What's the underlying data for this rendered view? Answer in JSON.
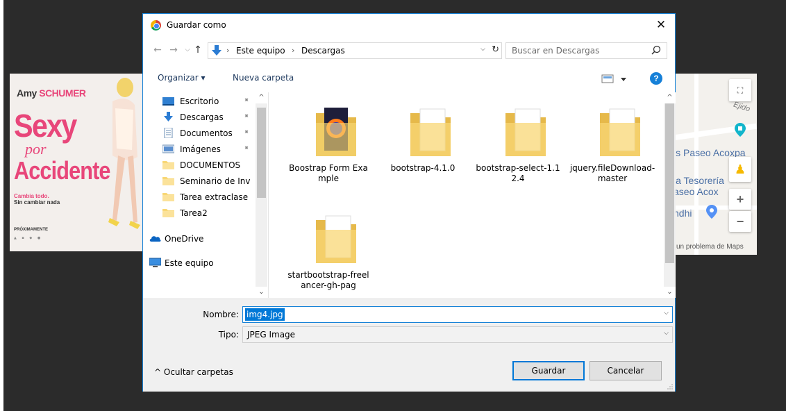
{
  "dialog": {
    "title": "Guardar como",
    "close": "✕"
  },
  "nav": {
    "back": "←",
    "forward": "→",
    "recent": "⌵",
    "up": "↑",
    "breadcrumbs": [
      "Este equipo",
      "Descargas"
    ],
    "separator": "›",
    "address_dropdown": "⌵",
    "refresh": "↻",
    "search_placeholder": "Buscar en Descargas"
  },
  "toolbar": {
    "organize": "Organizar ▾",
    "new_folder": "Nueva carpeta",
    "help": "?"
  },
  "sidebar": {
    "items": [
      {
        "label": "Escritorio",
        "icon": "desktop-icon",
        "pinned": true
      },
      {
        "label": "Descargas",
        "icon": "download-icon",
        "pinned": true
      },
      {
        "label": "Documentos",
        "icon": "document-icon",
        "pinned": true
      },
      {
        "label": "Imágenes",
        "icon": "image-icon",
        "pinned": true
      },
      {
        "label": "DOCUMENTOS",
        "icon": "folder-icon",
        "pinned": false
      },
      {
        "label": "Seminario de Inv",
        "icon": "folder-icon",
        "pinned": false
      },
      {
        "label": "Tarea extraclase",
        "icon": "folder-icon",
        "pinned": false
      },
      {
        "label": "Tarea2",
        "icon": "folder-icon",
        "pinned": false
      },
      {
        "label": "OneDrive",
        "icon": "cloud-icon",
        "pinned": false
      },
      {
        "label": "Este equipo",
        "icon": "computer-icon",
        "pinned": false
      }
    ],
    "scroll_up": "^",
    "scroll_down": "⌄",
    "pin": "📌"
  },
  "files": {
    "items": [
      {
        "label": "Boostrap Form Example",
        "icon": "folder-firefox-icon"
      },
      {
        "label": "bootstrap-4.1.0",
        "icon": "folder-icon"
      },
      {
        "label": "bootstrap-select-1.12.4",
        "icon": "folder-icon"
      },
      {
        "label": "jquery.fileDownload-master",
        "icon": "folder-icon"
      },
      {
        "label": "startbootstrap-freelancer-gh-pag",
        "icon": "folder-icon"
      }
    ],
    "scroll_up": "^",
    "scroll_down": "⌄"
  },
  "form": {
    "name_label": "Nombre:",
    "name_value": "img4.jpg",
    "type_label": "Tipo:",
    "type_value": "JPEG Image",
    "dropdown": "⌵"
  },
  "footer": {
    "hide_folders": "^  Ocultar carpetas",
    "save": "Guardar",
    "cancel": "Cancelar"
  },
  "background": {
    "poster": {
      "actor_first": "Amy ",
      "actor_last": "SCHUMER",
      "title1": "Sexy",
      "title2": "por",
      "title3": "Accidente",
      "tag1": "Cambia todo.",
      "tag2": "Sin cambiar nada",
      "soon": "PRÓXIMAMENTE"
    },
    "map": {
      "ejido": "Ejido",
      "label1": "is Paseo Acoxpa",
      "label2": "la Tesorería",
      "label3": "aseo Acox",
      "label4": "ndhi",
      "error": "un problema de Maps",
      "zoom_in": "+",
      "zoom_out": "−"
    }
  },
  "colors": {
    "accent": "#0078d7",
    "border": "#1883d7",
    "folder": "#f8d775",
    "poster_pink": "#e8467a"
  }
}
